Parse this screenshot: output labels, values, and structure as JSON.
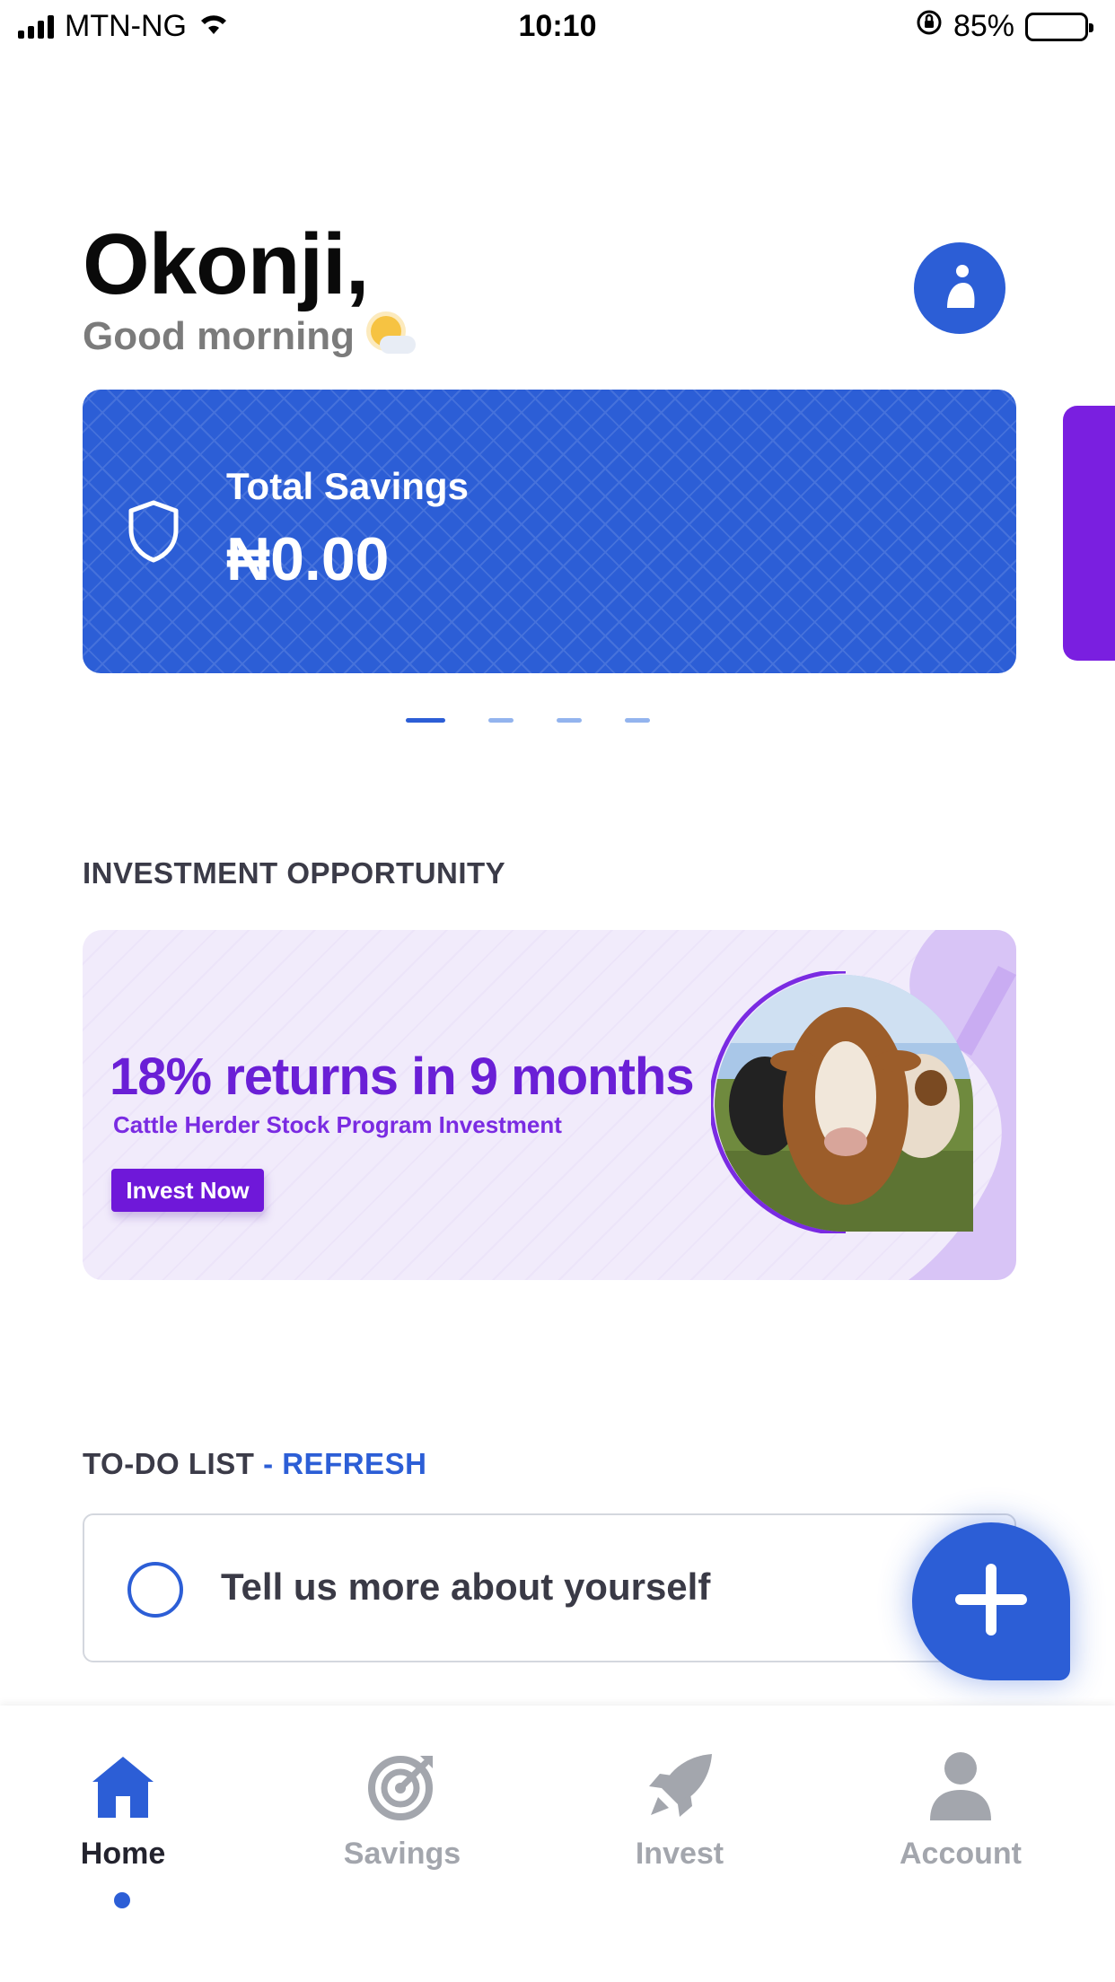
{
  "status_bar": {
    "carrier": "MTN-NG",
    "time": "10:10",
    "battery": "85%",
    "battery_level": 0.85
  },
  "greeting": {
    "name": "Okonji,",
    "message": "Good morning"
  },
  "savings_card": {
    "label": "Total Savings",
    "amount": "₦0.00",
    "icon": "shield-icon"
  },
  "carousel": {
    "page_count": 4,
    "active_index": 0
  },
  "investment": {
    "section_title": "INVESTMENT OPPORTUNITY",
    "headline": "18% returns in 9 months",
    "subtitle": "Cattle Herder Stock Program Investment",
    "cta": "Invest Now"
  },
  "todo": {
    "section_title": "TO-DO LIST",
    "refresh_label": "- REFRESH",
    "items": [
      {
        "text": "Tell us more about yourself",
        "done": false
      }
    ]
  },
  "fab": {
    "icon": "plus-icon"
  },
  "bottom_nav": {
    "active": "home",
    "items": [
      {
        "key": "home",
        "label": "Home",
        "icon": "home-icon"
      },
      {
        "key": "savings",
        "label": "Savings",
        "icon": "target-icon"
      },
      {
        "key": "invest",
        "label": "Invest",
        "icon": "rocket-icon"
      },
      {
        "key": "account",
        "label": "Account",
        "icon": "user-icon"
      }
    ]
  },
  "colors": {
    "primary": "#2c5ed6",
    "accent_purple": "#6f18d9",
    "banner_bg": "#f1ebfb",
    "nav_inactive": "#a3a6ad"
  }
}
